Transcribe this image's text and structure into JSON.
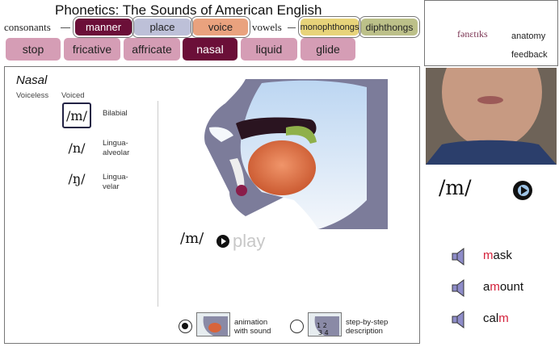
{
  "app": {
    "title": "Phonetics:  The Sounds of American English"
  },
  "row1": {
    "consonants_label": "consonants",
    "tabs": [
      {
        "label": "manner",
        "bg": "#6b0f38",
        "fg": "#ffffff"
      },
      {
        "label": "place",
        "bg": "#bdc0d8",
        "fg": "#222222"
      },
      {
        "label": "voice",
        "bg": "#e9a27e",
        "fg": "#222222"
      }
    ],
    "vowels_label": "vowels",
    "vowel_tabs": [
      {
        "label": "monophthongs",
        "bg": "#e7d37a",
        "fg": "#222222"
      },
      {
        "label": "diphthongs",
        "bg": "#bcc089",
        "fg": "#222222"
      }
    ]
  },
  "row2": {
    "tabs": [
      {
        "label": "stop",
        "bg": "#d59db5",
        "fg": "#222222"
      },
      {
        "label": "fricative",
        "bg": "#d59db5",
        "fg": "#222222"
      },
      {
        "label": "affricate",
        "bg": "#d59db5",
        "fg": "#222222"
      },
      {
        "label": "nasal",
        "bg": "#6b0f38",
        "fg": "#ffffff"
      },
      {
        "label": "liquid",
        "bg": "#d59db5",
        "fg": "#222222"
      },
      {
        "label": "glide",
        "bg": "#d59db5",
        "fg": "#222222"
      }
    ]
  },
  "top_right": {
    "logo": "fənɛtɪks",
    "anatomy": "anatomy",
    "feedback": "feedback"
  },
  "panel": {
    "title": "Nasal",
    "voiceless_label": "Voiceless",
    "voiced_label": "Voiced",
    "phonemes": [
      {
        "symbol": "/m/",
        "place": "Bilabial"
      },
      {
        "symbol": "/n/",
        "place": "Lingua-\nalveolar"
      },
      {
        "symbol": "/ŋ/",
        "place": "Lingua-\nvelar"
      }
    ],
    "current_symbol": "/m/",
    "play_label": "play",
    "options": [
      {
        "label": "animation\nwith sound",
        "selected": true
      },
      {
        "label": "step-by-step\ndescription",
        "selected": false
      }
    ]
  },
  "right": {
    "symbol": "/m/",
    "words": [
      {
        "pre": "",
        "hl": "m",
        "post": "ask"
      },
      {
        "pre": "a",
        "hl": "m",
        "post": "ount"
      },
      {
        "pre": "cal",
        "hl": "m",
        "post": ""
      }
    ]
  },
  "colors": {
    "accent": "#6b0f38",
    "highlight": "#d4203a",
    "speaker": "#8e8cc8"
  }
}
